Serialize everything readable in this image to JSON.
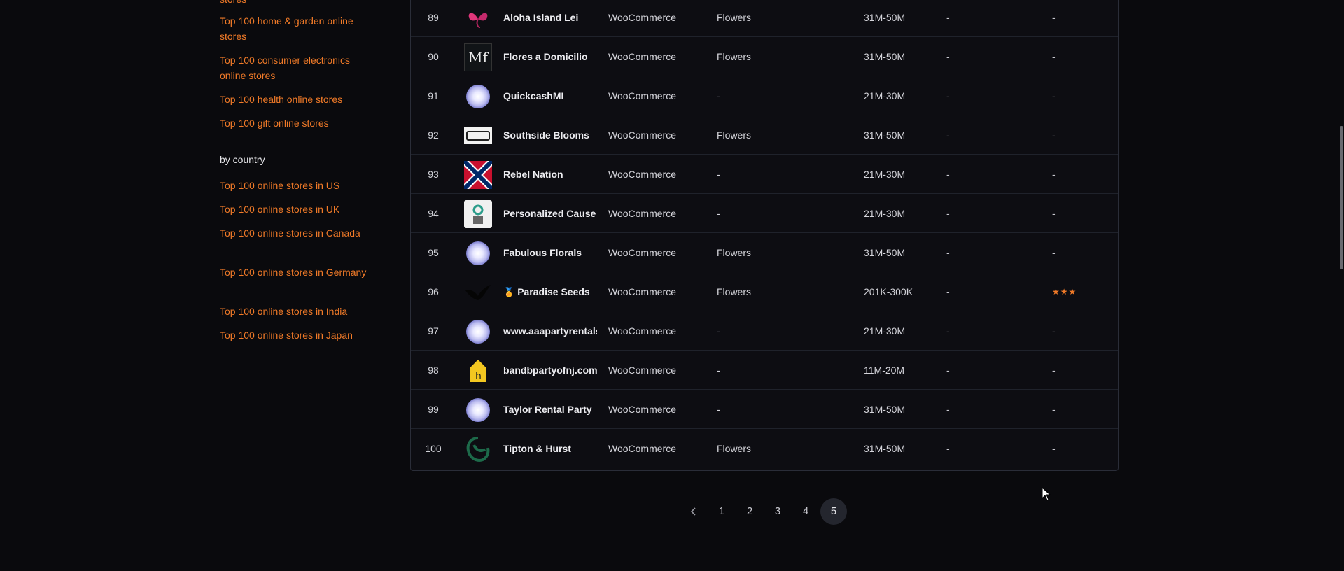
{
  "sidebar": {
    "top_cut_text": "stores",
    "links_top": [
      "Top 100 home & garden online stores",
      "Top 100 consumer electronics online stores",
      "Top 100 health online stores",
      "Top 100 gift online stores"
    ],
    "country_heading": "by country",
    "links_country": [
      "Top 100 online stores in US",
      "Top 100 online stores in UK",
      "Top 100 online stores in Canada",
      "Top 100 online stores in Germany",
      "Top 100 online stores in India",
      "Top 100 online stores in Japan"
    ]
  },
  "table": {
    "rows": [
      {
        "rank": "89",
        "logo": "flower-logo",
        "name": "Aloha Island Lei",
        "platform": "WooCommerce",
        "category": "Flowers",
        "traffic": "31M-50M",
        "growth": "-",
        "rating": "-"
      },
      {
        "rank": "90",
        "logo": "mf-logo",
        "name": "Flores a Domicilio",
        "platform": "WooCommerce",
        "category": "Flowers",
        "traffic": "31M-50M",
        "growth": "-",
        "rating": "-"
      },
      {
        "rank": "91",
        "logo": "globe-logo",
        "name": "QuickcashMI",
        "platform": "WooCommerce",
        "category": "-",
        "traffic": "21M-30M",
        "growth": "-",
        "rating": "-"
      },
      {
        "rank": "92",
        "logo": "southside-logo",
        "name": "Southside Blooms",
        "platform": "WooCommerce",
        "category": "Flowers",
        "traffic": "31M-50M",
        "growth": "-",
        "rating": "-"
      },
      {
        "rank": "93",
        "logo": "flag-logo",
        "name": "Rebel Nation",
        "platform": "WooCommerce",
        "category": "-",
        "traffic": "21M-30M",
        "growth": "-",
        "rating": "-"
      },
      {
        "rank": "94",
        "logo": "cause-logo",
        "name": "Personalized Cause",
        "platform": "WooCommerce",
        "category": "-",
        "traffic": "21M-30M",
        "growth": "-",
        "rating": "-"
      },
      {
        "rank": "95",
        "logo": "globe-logo",
        "name": "Fabulous Florals",
        "platform": "WooCommerce",
        "category": "Flowers",
        "traffic": "31M-50M",
        "growth": "-",
        "rating": "-"
      },
      {
        "rank": "96",
        "logo": "bird-logo",
        "name": "Paradise Seeds",
        "medal": true,
        "platform": "WooCommerce",
        "category": "Flowers",
        "traffic": "201K-300K",
        "growth": "-",
        "rating": "★★★"
      },
      {
        "rank": "97",
        "logo": "globe-logo",
        "name": "www.aaapartyrentals",
        "platform": "WooCommerce",
        "category": "-",
        "traffic": "21M-30M",
        "growth": "-",
        "rating": "-"
      },
      {
        "rank": "98",
        "logo": "house-logo",
        "name": "bandbpartyofnj.com",
        "platform": "WooCommerce",
        "category": "-",
        "traffic": "11M-20M",
        "growth": "-",
        "rating": "-"
      },
      {
        "rank": "99",
        "logo": "globe-logo",
        "name": "Taylor Rental Party",
        "platform": "WooCommerce",
        "category": "-",
        "traffic": "31M-50M",
        "growth": "-",
        "rating": "-"
      },
      {
        "rank": "100",
        "logo": "tipton-logo",
        "name": "Tipton & Hurst",
        "platform": "WooCommerce",
        "category": "Flowers",
        "traffic": "31M-50M",
        "growth": "-",
        "rating": "-"
      }
    ]
  },
  "pagination": {
    "prev_icon": "chevron-left-icon",
    "pages": [
      "1",
      "2",
      "3",
      "4",
      "5"
    ],
    "active": "5"
  },
  "colors": {
    "background": "#0a0a0d",
    "accent_link": "#f07a28",
    "active_page_bg": "#24262e"
  }
}
